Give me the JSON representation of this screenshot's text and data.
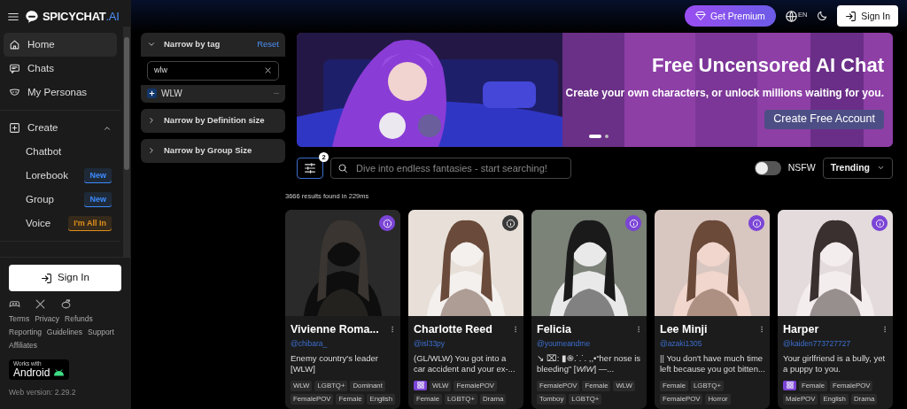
{
  "header": {
    "brand": "SPICYCHAT",
    "brand_suffix": ".AI",
    "premium": "Get Premium",
    "language": "EN",
    "sign_in": "Sign In"
  },
  "sidebar": {
    "items": [
      {
        "kind": "nav",
        "label": "Home",
        "selected": true
      },
      {
        "kind": "nav",
        "label": "Chats",
        "selected": false
      },
      {
        "kind": "nav",
        "label": "My Personas",
        "selected": false
      },
      {
        "kind": "group",
        "label": "Create",
        "expanded": true,
        "children": [
          {
            "label": "Chatbot"
          },
          {
            "label": "Lorebook",
            "badge": "New",
            "color": "#3d8bfd"
          },
          {
            "label": "Group",
            "badge": "New",
            "color": "#3d8bfd"
          },
          {
            "label": "Voice",
            "badge": "I'm All In",
            "color": "#e0901c"
          }
        ]
      }
    ],
    "sign_in": "Sign In",
    "links": [
      "Terms",
      "Privacy",
      "Refunds",
      "Reporting",
      "Guidelines",
      "Support",
      "Affiliates"
    ],
    "store_badge": {
      "caption": "Works with",
      "label": "Android"
    },
    "version": "Web version: 2.29.2"
  },
  "filters": [
    {
      "title": "Narrow by tag",
      "expanded": true,
      "action": "Reset",
      "search_value": "wlw",
      "tags": [
        {
          "label": "WLW"
        }
      ]
    },
    {
      "title": "Narrow by Definition size",
      "expanded": false
    },
    {
      "title": "Narrow by Group Size",
      "expanded": false
    }
  ],
  "banner": {
    "title": "Free Uncensored AI Chat",
    "subtitle": "Create your own characters, or unlock millions waiting for you.",
    "button": "Create Free Account",
    "dots": [
      {
        "selected": true
      },
      {
        "selected": false
      }
    ]
  },
  "toolbar": {
    "filter_count": "2",
    "placeholder": "Dive into endless fantasies - start searching!",
    "nsfw": {
      "label": "NSFW",
      "on": false
    },
    "sort": "Trending"
  },
  "results": "3666 results found in 229ms",
  "cards": [
    {
      "name": "Vivienne Roma...",
      "handle": "@chibara_",
      "description": "Enemy country's leader [WLW]",
      "info_highlighted": true,
      "group_badge": false,
      "tags": [
        "WLW",
        "LGBTQ+",
        "Dominant",
        "FemalePOV",
        "Female",
        "English"
      ]
    },
    {
      "name": "Charlotte Reed",
      "handle": "@isl33py",
      "description": "(GL/WLW) You got into a car accident and your ex-...",
      "info_highlighted": false,
      "group_badge": true,
      "tags": [
        "WLW",
        "FemalePOV",
        "Female",
        "LGBTQ+",
        "Drama"
      ]
    },
    {
      "name": "Felicia",
      "handle": "@youmeandme",
      "description": "↘ ⌧: ▮֍.˙.˙. ,,•“her nose is bleeding” [*WlW*] —...",
      "info_highlighted": true,
      "group_badge": false,
      "tags": [
        "FemalePOV",
        "Female",
        "WLW",
        "Tomboy",
        "LGBTQ+"
      ]
    },
    {
      "name": "Lee Minji",
      "handle": "@azaki1305",
      "description": "|| You don't have much time left because you got bitten...",
      "info_highlighted": true,
      "group_badge": false,
      "tags": [
        "Female",
        "LGBTQ+",
        "FemalePOV",
        "Horror"
      ]
    },
    {
      "name": "Harper",
      "handle": "@kaiden773727727",
      "description": "Your girlfriend is a bully, yet a puppy to you.",
      "info_highlighted": true,
      "group_badge": true,
      "tags": [
        "Female",
        "FemalePOV",
        "MalePOV",
        "English",
        "Drama"
      ]
    }
  ]
}
